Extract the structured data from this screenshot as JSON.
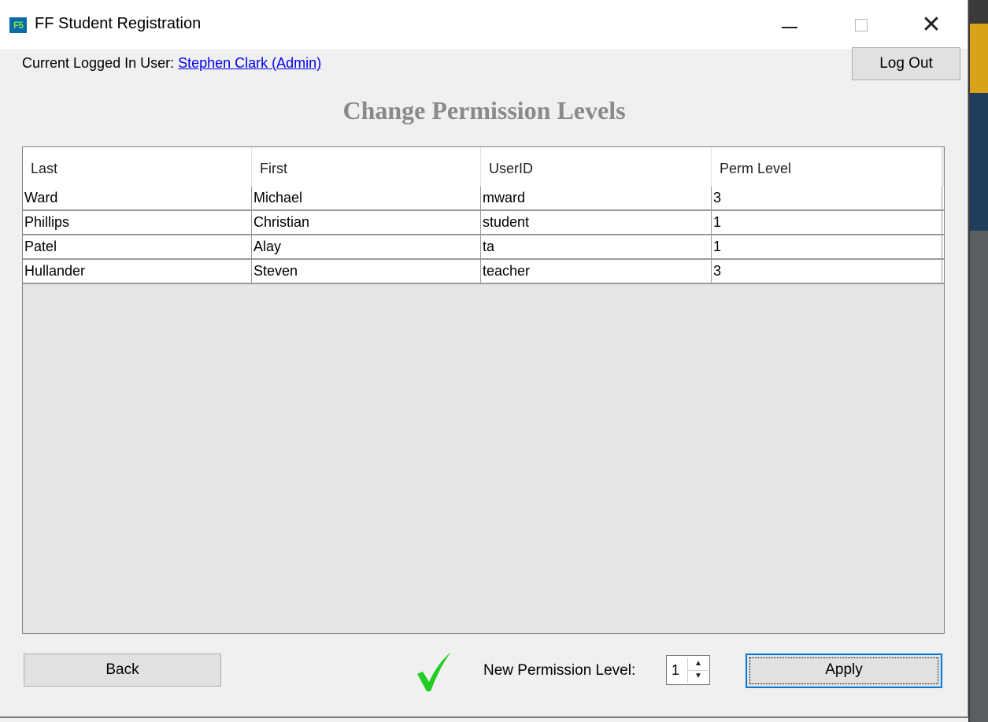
{
  "window": {
    "title": "FF Student Registration",
    "app_icon_text": "F5",
    "close_glyph": "✕"
  },
  "header": {
    "user_prefix": "Current Logged In User: ",
    "user_name": "Stephen Clark (Admin)",
    "logout_label": "Log Out"
  },
  "page": {
    "title": "Change Permission Levels"
  },
  "table": {
    "columns": [
      "Last",
      "First",
      "UserID",
      "Perm Level"
    ],
    "rows": [
      [
        "Ward",
        "Michael",
        "mward",
        "3"
      ],
      [
        "Phillips",
        "Christian",
        "student",
        "1"
      ],
      [
        "Patel",
        "Alay",
        "ta",
        "1"
      ],
      [
        "Hullander",
        "Steven",
        "teacher",
        "3"
      ]
    ]
  },
  "footer": {
    "back_label": "Back",
    "status_icon": "check-icon",
    "perm_label": "New Permission Level:",
    "perm_value": "1",
    "apply_label": "Apply"
  },
  "colors": {
    "link": "#0000ee",
    "title_gray": "#8a8a8a",
    "check_green": "#22cc22",
    "focus_blue": "#0078d7"
  }
}
